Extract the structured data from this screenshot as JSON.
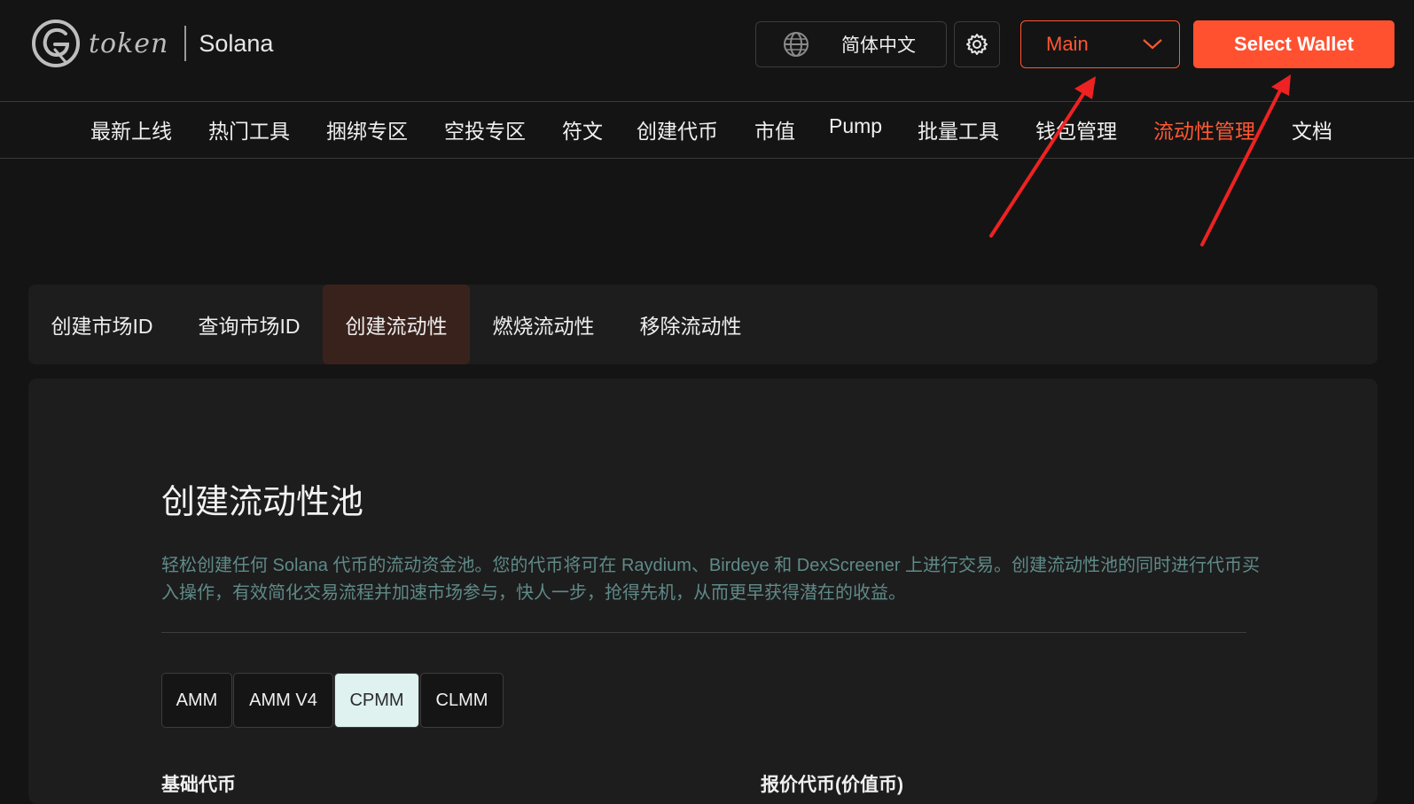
{
  "header": {
    "logo_text": "token",
    "chain": "Solana",
    "language": "简体中文",
    "icons": {
      "language": "globe-icon",
      "settings": "gear-icon",
      "network_dropdown": "chevron-down-icon"
    },
    "network": "Main",
    "wallet_button": "Select Wallet"
  },
  "nav": {
    "items": [
      {
        "label": "最新上线"
      },
      {
        "label": "热门工具"
      },
      {
        "label": "捆绑专区"
      },
      {
        "label": "空投专区"
      },
      {
        "label": "符文"
      },
      {
        "label": "创建代币"
      },
      {
        "label": "市值"
      },
      {
        "label": "Pump"
      },
      {
        "label": "批量工具"
      },
      {
        "label": "钱包管理"
      },
      {
        "label": "流动性管理"
      },
      {
        "label": "文档"
      }
    ],
    "active_index": 10
  },
  "subtabs": {
    "items": [
      {
        "label": "创建市场ID"
      },
      {
        "label": "查询市场ID"
      },
      {
        "label": "创建流动性"
      },
      {
        "label": "燃烧流动性"
      },
      {
        "label": "移除流动性"
      }
    ],
    "active_index": 2
  },
  "main": {
    "title": "创建流动性池",
    "description": "轻松创建任何 Solana 代币的流动资金池。您的代币将可在 Raydium、Birdeye 和 DexScreener 上进行交易。创建流动性池的同时进行代币买入操作，有效简化交易流程并加速市场参与，快人一步，抢得先机，从而更早获得潜在的收益。",
    "pool_types": [
      {
        "label": "AMM"
      },
      {
        "label": "AMM V4"
      },
      {
        "label": "CPMM"
      },
      {
        "label": "CLMM"
      }
    ],
    "active_pool_type": "CPMM",
    "base_token_label": "基础代币",
    "quote_token_label": "报价代币(价值币)"
  },
  "colors": {
    "accent": "#ff5733",
    "background": "#141414",
    "panel": "#1d1d1d",
    "active_tab_bg": "#3a221c",
    "description_text": "#5f8a88",
    "annotation_arrow": "#ee2222"
  }
}
